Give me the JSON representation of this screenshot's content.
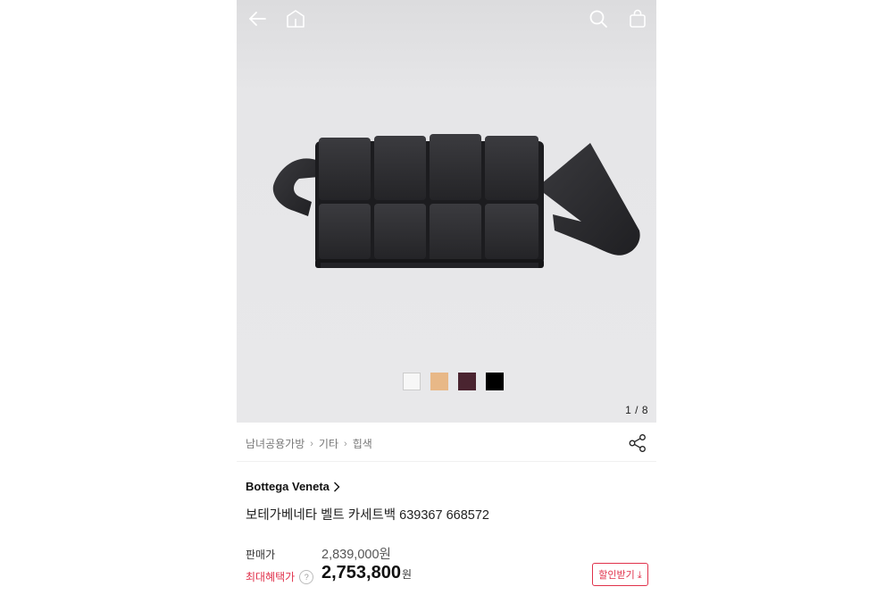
{
  "header": {
    "icons": [
      "back-arrow-icon",
      "home-icon",
      "search-icon",
      "shopping-bag-icon"
    ]
  },
  "gallery": {
    "counter": "1 / 8",
    "swatches": [
      {
        "color": "#f7f7f7",
        "border": "#cccccc"
      },
      {
        "color": "#e8b887",
        "border": "#e8b887"
      },
      {
        "color": "#4a2430",
        "border": "#4a2430"
      },
      {
        "color": "#000000",
        "border": "#000000"
      }
    ]
  },
  "breadcrumb": [
    "남녀공용가방",
    "기타",
    "힙색"
  ],
  "product": {
    "brand": "Bottega Veneta",
    "name": "보테가베네타 벨트 카세트백 639367 668572"
  },
  "pricing": {
    "price_label": "판매가",
    "price_value": "2,839,000원",
    "benefit_label": "최대혜택가",
    "help_icon_text": "?",
    "benefit_value": "2,753,800",
    "benefit_unit": "원",
    "coupon_button": "할인받기 ⤓"
  },
  "colors": {
    "accent": "#e0314b",
    "bag": "#2b2b2e"
  }
}
